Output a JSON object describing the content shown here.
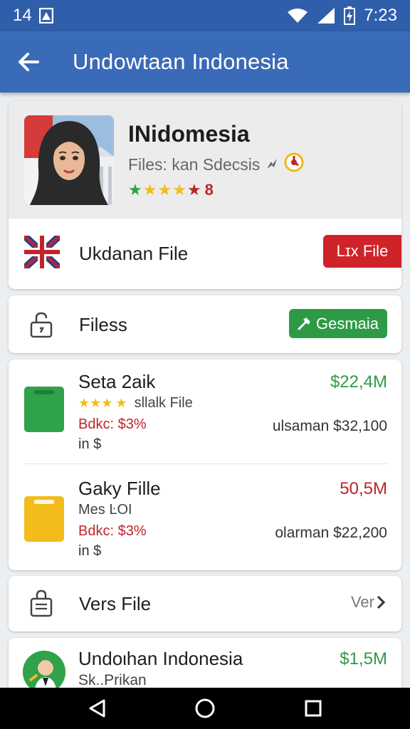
{
  "status_bar": {
    "time_left": "14",
    "time_right": "7:23"
  },
  "app_bar": {
    "title": "Undowtaan Indonesia"
  },
  "profile": {
    "name": "INidomesia",
    "subtitle": "Files: kan Sdecsis",
    "rating_badge": "8",
    "file_row_label": "Ukdanan File",
    "file_row_button": "Lɪx File"
  },
  "files_card": {
    "label": "Filess",
    "button_label": "Gesmaia"
  },
  "items": [
    {
      "title": "Seta 2aik",
      "sub": "sllalk File",
      "bdkc": "Bdkc: $3%",
      "in": "in $",
      "price": "$22,4M",
      "sub_price": "ulsaman $32,100",
      "price_color": "#2d9b45",
      "icon_color": "#2fa24a"
    },
    {
      "title": "Gaky Fille",
      "sub": "Mes ĿOI",
      "bdkc": "Bdkc: $3%",
      "in": "in $",
      "price": "50,5M",
      "sub_price": "olarman $22,200",
      "price_color": "#c0242a",
      "icon_color": "#f2bc1a"
    }
  ],
  "vers_card": {
    "label": "Vers File",
    "right_label": "Ver"
  },
  "last_item": {
    "title": "Undoιhan Indonesia",
    "sub": "Sk..Prikan",
    "price": "$1,5M"
  },
  "icons": {
    "back": "arrow-left-icon",
    "lock": "lock-icon",
    "clipboard": "clipboard-lock-icon",
    "wifi": "wifi-icon",
    "signal": "signal-icon",
    "battery": "battery-icon"
  },
  "colors": {
    "app_bar": "#3a6bb8",
    "status_bar": "#2f5eaa",
    "green": "#2d9b45",
    "red": "#cf2329"
  }
}
